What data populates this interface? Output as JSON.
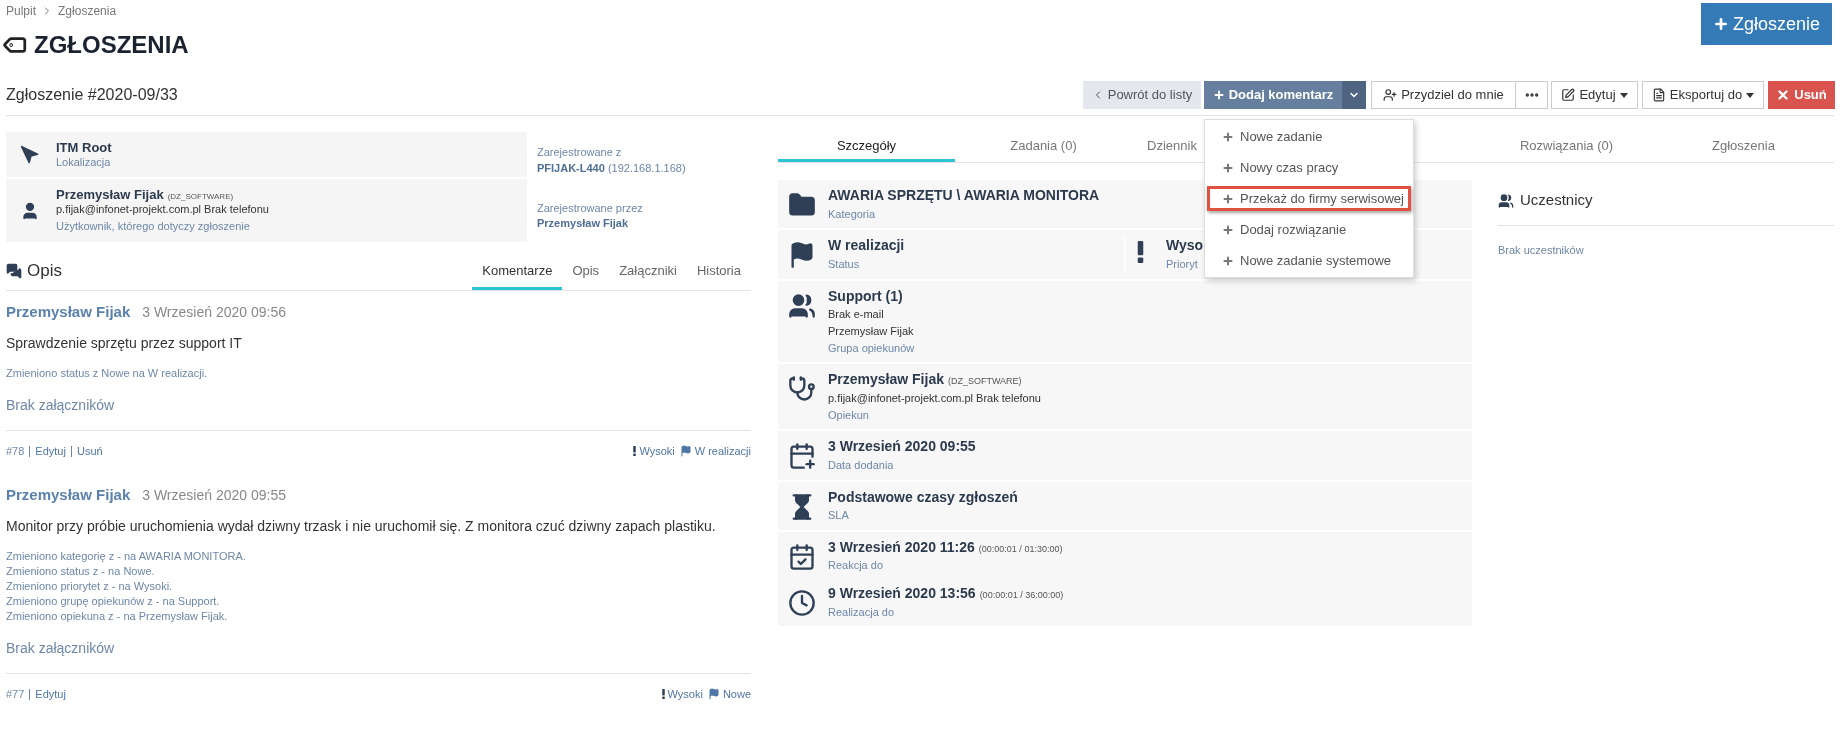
{
  "breadcrumb": [
    {
      "label": "Pulpit"
    },
    {
      "label": "Zgłoszenia"
    }
  ],
  "page_title": "ZGŁOSZENIA",
  "new_button": "Zgłoszenie",
  "ticket_title": "Zgłoszenie #2020-09/33",
  "toolbar": [
    {
      "kind": "back",
      "label": "Powrót do listy"
    },
    {
      "kind": "split",
      "label": "Dodaj komentarz"
    },
    {
      "kind": "assign",
      "label": "Przydziel do mnie"
    },
    {
      "kind": "more"
    },
    {
      "kind": "edit",
      "label": "Edytuj"
    },
    {
      "kind": "export",
      "label": "Eksportuj do"
    },
    {
      "kind": "delete",
      "label": "Usuń"
    }
  ],
  "dropdown": [
    {
      "label": "Nowe zadanie",
      "highlighted": false
    },
    {
      "label": "Nowy czas pracy",
      "highlighted": false
    },
    {
      "label": "Przekaż do firmy serwisowej",
      "highlighted": true
    },
    {
      "label": "Dodaj rozwiązanie",
      "highlighted": false
    },
    {
      "label": "Nowe zadanie systemowe",
      "highlighted": false
    }
  ],
  "info": {
    "location": {
      "name": "ITM Root",
      "label": "Lokalizacja"
    },
    "user": {
      "name": "Przemysław Fijak",
      "code": "(DZ_SOFTWARE)",
      "contact": "p.fijak@infonet-projekt.com.pl Brak telefonu",
      "label": "Użytkownik, którego dotyczy zgłoszenie"
    },
    "registered_from": {
      "label": "Zarejestrowane z",
      "host": "PFIJAK-L440",
      "ip": "(192.168.1.168)"
    },
    "registered_by": {
      "label": "Zarejestrowane przez",
      "name": "Przemysław Fijak"
    }
  },
  "description": {
    "title": "Opis",
    "tabs": [
      {
        "label": "Komentarze",
        "selected": true
      },
      {
        "label": "Opis",
        "selected": false
      },
      {
        "label": "Załączniki",
        "selected": false
      },
      {
        "label": "Historia",
        "selected": false
      }
    ],
    "comments": [
      {
        "author": "Przemysław Fijak",
        "date": "3 Wrzesień 2020 09:56",
        "text": "Sprawdzenie sprzętu przez support IT",
        "changes": [
          "Zmieniono status z Nowe na W realizacji."
        ],
        "attachments": "Brak załączników",
        "number": "#78",
        "actions": [
          "Edytuj",
          "Usuń"
        ],
        "priority": "Wysoki",
        "status": "W realizacji"
      },
      {
        "author": "Przemysław Fijak",
        "date": "3 Wrzesień 2020 09:55",
        "text": "Monitor przy próbie uruchomienia wydał dziwny trzask i nie uruchomił się. Z monitora czuć dziwny zapach plastiku.",
        "changes": [
          "Zmieniono kategorię z - na AWARIA MONITORA.",
          "Zmieniono status z - na Nowe.",
          "Zmieniono priorytet z - na Wysoki.",
          "Zmieniono grupę opiekunów z - na Support.",
          "Zmieniono opiekuna z - na Przemysław Fijak."
        ],
        "attachments": "Brak załączników",
        "number": "#77",
        "actions": [
          "Edytuj"
        ],
        "priority": "Wysoki",
        "status": "Nowe"
      }
    ]
  },
  "detail_tabs": [
    {
      "label": "Szczegóły",
      "selected": true
    },
    {
      "label": "Zadania (0)",
      "selected": false
    },
    {
      "label": "Dziennik",
      "selected": false
    },
    {
      "label": "Rozwiązania (0)",
      "selected": false
    },
    {
      "label": "Zgłoszenia",
      "selected": false
    }
  ],
  "details": [
    {
      "kind": "stack",
      "items": [
        {
          "kind": "category",
          "title": "AWARIA SPRZĘTU \\ AWARIA MONITORA",
          "label": "Kategoria"
        }
      ]
    },
    {
      "kind": "pair",
      "items": [
        {
          "kind": "status",
          "title": "W realizacji",
          "label": "Status"
        },
        {
          "kind": "priority",
          "title": "Wyso",
          "label": "Prioryt"
        }
      ]
    },
    {
      "kind": "stack",
      "items": [
        {
          "kind": "group",
          "title": "Support (1)",
          "lines": [
            "Brak e-mail",
            "Przemysław Fijak"
          ],
          "label": "Grupa opiekunów"
        }
      ]
    },
    {
      "kind": "stack",
      "items": [
        {
          "kind": "assignee",
          "title": "Przemysław Fijak",
          "note": "(DZ_SOFTWARE)",
          "lines": [
            "p.fijak@infonet-projekt.com.pl Brak telefonu"
          ],
          "label": "Opiekun"
        }
      ]
    },
    {
      "kind": "stack",
      "items": [
        {
          "kind": "created",
          "title": "3 Wrzesień 2020 09:55",
          "label": "Data dodania"
        }
      ]
    },
    {
      "kind": "stack",
      "items": [
        {
          "kind": "sla",
          "title": "Podstawowe czasy zgłoszeń",
          "label": "SLA"
        }
      ]
    },
    {
      "kind": "stack",
      "items": [
        {
          "kind": "reaction",
          "title": "3 Wrzesień 2020 11:26",
          "note": "(00:00:01 / 01:30:00)",
          "label": "Reakcja do"
        },
        {
          "kind": "resolution",
          "title": "9 Wrzesień 2020 13:56",
          "note": "(00:00:01 / 36:00:00)",
          "label": "Realizacja do"
        }
      ]
    }
  ],
  "participants": {
    "title": "Uczestnicy",
    "empty": "Brak uczestników"
  }
}
